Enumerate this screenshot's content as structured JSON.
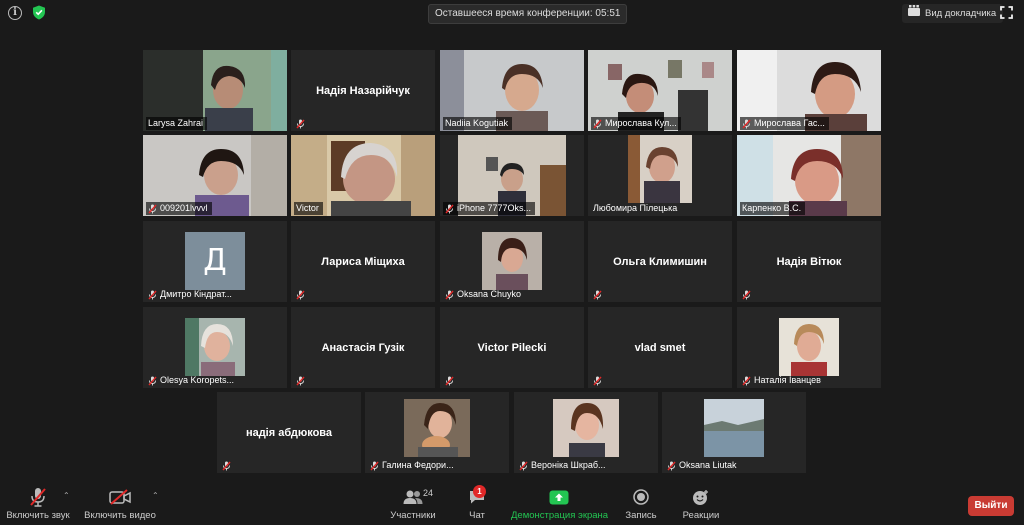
{
  "topbar": {
    "timer_text": "Оставшееся время конференции: 05:51",
    "view_label": "Вид докладчика"
  },
  "participants": [
    {
      "name": "Larysa Zahrai",
      "type": "video",
      "muted": false
    },
    {
      "name": "Надія Назарійчук",
      "type": "name",
      "muted": true
    },
    {
      "name": "Nadiia Kogutiak",
      "type": "video",
      "muted": false
    },
    {
      "name": "Мирослава Кул...",
      "type": "video",
      "muted": true
    },
    {
      "name": "Мирослава Гас...",
      "type": "video",
      "muted": true
    },
    {
      "name": "009201lvvvl",
      "type": "video",
      "muted": true
    },
    {
      "name": "Victor",
      "type": "video",
      "muted": false,
      "speaking": true
    },
    {
      "name": "iPhone 7777Oks...",
      "type": "video",
      "muted": true
    },
    {
      "name": "Любомира Пілецька",
      "type": "video",
      "muted": false
    },
    {
      "name": "Карпенко В.С.",
      "type": "video",
      "muted": false
    },
    {
      "name": "Дмитро Кіндрат...",
      "type": "letter",
      "letter": "Д",
      "muted": true
    },
    {
      "name": "Лариса Міщиха",
      "type": "name",
      "muted": true
    },
    {
      "name": "Oksana Chuyko",
      "type": "photo",
      "muted": true
    },
    {
      "name": "Ольга Климишин",
      "type": "name",
      "muted": true
    },
    {
      "name": "Надія Вітюк",
      "type": "name",
      "muted": true
    },
    {
      "name": "Olesya Koropets...",
      "type": "photo",
      "muted": true
    },
    {
      "name": "Анастасія Гузік",
      "type": "name",
      "muted": true
    },
    {
      "name": "Victor Pilecki",
      "type": "name",
      "muted": true
    },
    {
      "name": "vlad smet",
      "type": "name",
      "muted": true
    },
    {
      "name": "Наталія Іванцев",
      "type": "photo",
      "muted": true
    },
    {
      "name": "надія абдюкова",
      "type": "name",
      "muted": true
    },
    {
      "name": "Галина Федори...",
      "type": "photo",
      "muted": true
    },
    {
      "name": "Вероніка Шкраб...",
      "type": "photo",
      "muted": true
    },
    {
      "name": "Oksana Liutak",
      "type": "photo",
      "muted": true
    }
  ],
  "toolbar": {
    "audio_label": "Включить звук",
    "video_label": "Включить видео",
    "participants_label": "Участники",
    "participants_count": "24",
    "chat_label": "Чат",
    "chat_badge": "1",
    "share_label": "Демонстрация экрана",
    "record_label": "Запись",
    "reactions_label": "Реакции",
    "exit_label": "Выйти"
  },
  "colors": {
    "speaking_border": "#c8e64a",
    "share_green": "#23c552",
    "exit_red": "#c93b33",
    "mute_red": "#e02828"
  }
}
